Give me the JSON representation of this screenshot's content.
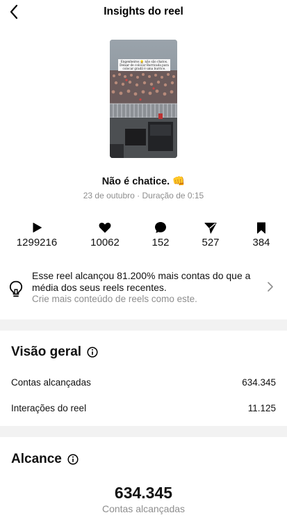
{
  "header": {
    "title": "Insights do reel",
    "back_icon": "chevron-left-icon"
  },
  "reel": {
    "thumbnail_caption": "Engenheiros 👷 não são chatos. Deixar de colocar Barricada para colocar gradil é uma burrice.",
    "title": "Não é chatice.",
    "title_emoji": "👊",
    "date": "23 de outubro",
    "duration_label": "Duração de 0:15"
  },
  "stats": [
    {
      "icon": "play-icon",
      "value": "1299216"
    },
    {
      "icon": "heart-icon",
      "value": "10062"
    },
    {
      "icon": "comment-icon",
      "value": "152"
    },
    {
      "icon": "share-icon",
      "value": "527"
    },
    {
      "icon": "bookmark-icon",
      "value": "384"
    }
  ],
  "hint": {
    "icon": "lightbulb-icon",
    "text": "Esse reel alcançou 81.200% mais contas do que a média dos seus reels recentes.",
    "subtext": "Crie mais conteúdo de reels como este."
  },
  "overview": {
    "title": "Visão geral",
    "rows": [
      {
        "label": "Contas alcançadas",
        "value": "634.345"
      },
      {
        "label": "Interações do reel",
        "value": "11.125"
      }
    ]
  },
  "reach": {
    "title": "Alcance",
    "value": "634.345",
    "label": "Contas alcançadas"
  }
}
